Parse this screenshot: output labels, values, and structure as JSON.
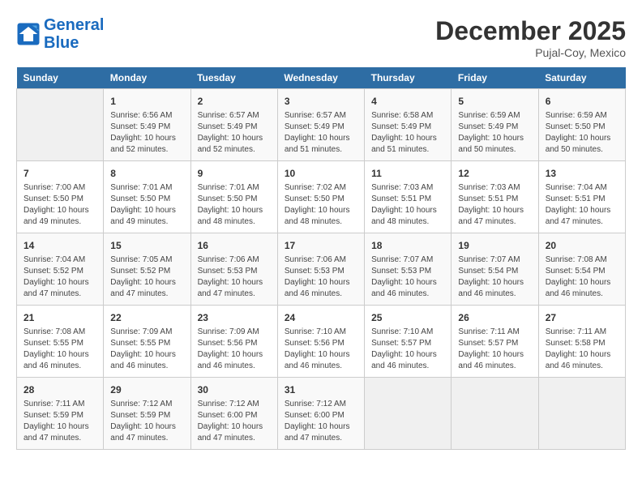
{
  "logo": {
    "line1": "General",
    "line2": "Blue"
  },
  "title": "December 2025",
  "subtitle": "Pujal-Coy, Mexico",
  "weekdays": [
    "Sunday",
    "Monday",
    "Tuesday",
    "Wednesday",
    "Thursday",
    "Friday",
    "Saturday"
  ],
  "weeks": [
    [
      {
        "day": "",
        "info": ""
      },
      {
        "day": "1",
        "info": "Sunrise: 6:56 AM\nSunset: 5:49 PM\nDaylight: 10 hours\nand 52 minutes."
      },
      {
        "day": "2",
        "info": "Sunrise: 6:57 AM\nSunset: 5:49 PM\nDaylight: 10 hours\nand 52 minutes."
      },
      {
        "day": "3",
        "info": "Sunrise: 6:57 AM\nSunset: 5:49 PM\nDaylight: 10 hours\nand 51 minutes."
      },
      {
        "day": "4",
        "info": "Sunrise: 6:58 AM\nSunset: 5:49 PM\nDaylight: 10 hours\nand 51 minutes."
      },
      {
        "day": "5",
        "info": "Sunrise: 6:59 AM\nSunset: 5:49 PM\nDaylight: 10 hours\nand 50 minutes."
      },
      {
        "day": "6",
        "info": "Sunrise: 6:59 AM\nSunset: 5:50 PM\nDaylight: 10 hours\nand 50 minutes."
      }
    ],
    [
      {
        "day": "7",
        "info": "Sunrise: 7:00 AM\nSunset: 5:50 PM\nDaylight: 10 hours\nand 49 minutes."
      },
      {
        "day": "8",
        "info": "Sunrise: 7:01 AM\nSunset: 5:50 PM\nDaylight: 10 hours\nand 49 minutes."
      },
      {
        "day": "9",
        "info": "Sunrise: 7:01 AM\nSunset: 5:50 PM\nDaylight: 10 hours\nand 48 minutes."
      },
      {
        "day": "10",
        "info": "Sunrise: 7:02 AM\nSunset: 5:50 PM\nDaylight: 10 hours\nand 48 minutes."
      },
      {
        "day": "11",
        "info": "Sunrise: 7:03 AM\nSunset: 5:51 PM\nDaylight: 10 hours\nand 48 minutes."
      },
      {
        "day": "12",
        "info": "Sunrise: 7:03 AM\nSunset: 5:51 PM\nDaylight: 10 hours\nand 47 minutes."
      },
      {
        "day": "13",
        "info": "Sunrise: 7:04 AM\nSunset: 5:51 PM\nDaylight: 10 hours\nand 47 minutes."
      }
    ],
    [
      {
        "day": "14",
        "info": "Sunrise: 7:04 AM\nSunset: 5:52 PM\nDaylight: 10 hours\nand 47 minutes."
      },
      {
        "day": "15",
        "info": "Sunrise: 7:05 AM\nSunset: 5:52 PM\nDaylight: 10 hours\nand 47 minutes."
      },
      {
        "day": "16",
        "info": "Sunrise: 7:06 AM\nSunset: 5:53 PM\nDaylight: 10 hours\nand 47 minutes."
      },
      {
        "day": "17",
        "info": "Sunrise: 7:06 AM\nSunset: 5:53 PM\nDaylight: 10 hours\nand 46 minutes."
      },
      {
        "day": "18",
        "info": "Sunrise: 7:07 AM\nSunset: 5:53 PM\nDaylight: 10 hours\nand 46 minutes."
      },
      {
        "day": "19",
        "info": "Sunrise: 7:07 AM\nSunset: 5:54 PM\nDaylight: 10 hours\nand 46 minutes."
      },
      {
        "day": "20",
        "info": "Sunrise: 7:08 AM\nSunset: 5:54 PM\nDaylight: 10 hours\nand 46 minutes."
      }
    ],
    [
      {
        "day": "21",
        "info": "Sunrise: 7:08 AM\nSunset: 5:55 PM\nDaylight: 10 hours\nand 46 minutes."
      },
      {
        "day": "22",
        "info": "Sunrise: 7:09 AM\nSunset: 5:55 PM\nDaylight: 10 hours\nand 46 minutes."
      },
      {
        "day": "23",
        "info": "Sunrise: 7:09 AM\nSunset: 5:56 PM\nDaylight: 10 hours\nand 46 minutes."
      },
      {
        "day": "24",
        "info": "Sunrise: 7:10 AM\nSunset: 5:56 PM\nDaylight: 10 hours\nand 46 minutes."
      },
      {
        "day": "25",
        "info": "Sunrise: 7:10 AM\nSunset: 5:57 PM\nDaylight: 10 hours\nand 46 minutes."
      },
      {
        "day": "26",
        "info": "Sunrise: 7:11 AM\nSunset: 5:57 PM\nDaylight: 10 hours\nand 46 minutes."
      },
      {
        "day": "27",
        "info": "Sunrise: 7:11 AM\nSunset: 5:58 PM\nDaylight: 10 hours\nand 46 minutes."
      }
    ],
    [
      {
        "day": "28",
        "info": "Sunrise: 7:11 AM\nSunset: 5:59 PM\nDaylight: 10 hours\nand 47 minutes."
      },
      {
        "day": "29",
        "info": "Sunrise: 7:12 AM\nSunset: 5:59 PM\nDaylight: 10 hours\nand 47 minutes."
      },
      {
        "day": "30",
        "info": "Sunrise: 7:12 AM\nSunset: 6:00 PM\nDaylight: 10 hours\nand 47 minutes."
      },
      {
        "day": "31",
        "info": "Sunrise: 7:12 AM\nSunset: 6:00 PM\nDaylight: 10 hours\nand 47 minutes."
      },
      {
        "day": "",
        "info": ""
      },
      {
        "day": "",
        "info": ""
      },
      {
        "day": "",
        "info": ""
      }
    ]
  ]
}
